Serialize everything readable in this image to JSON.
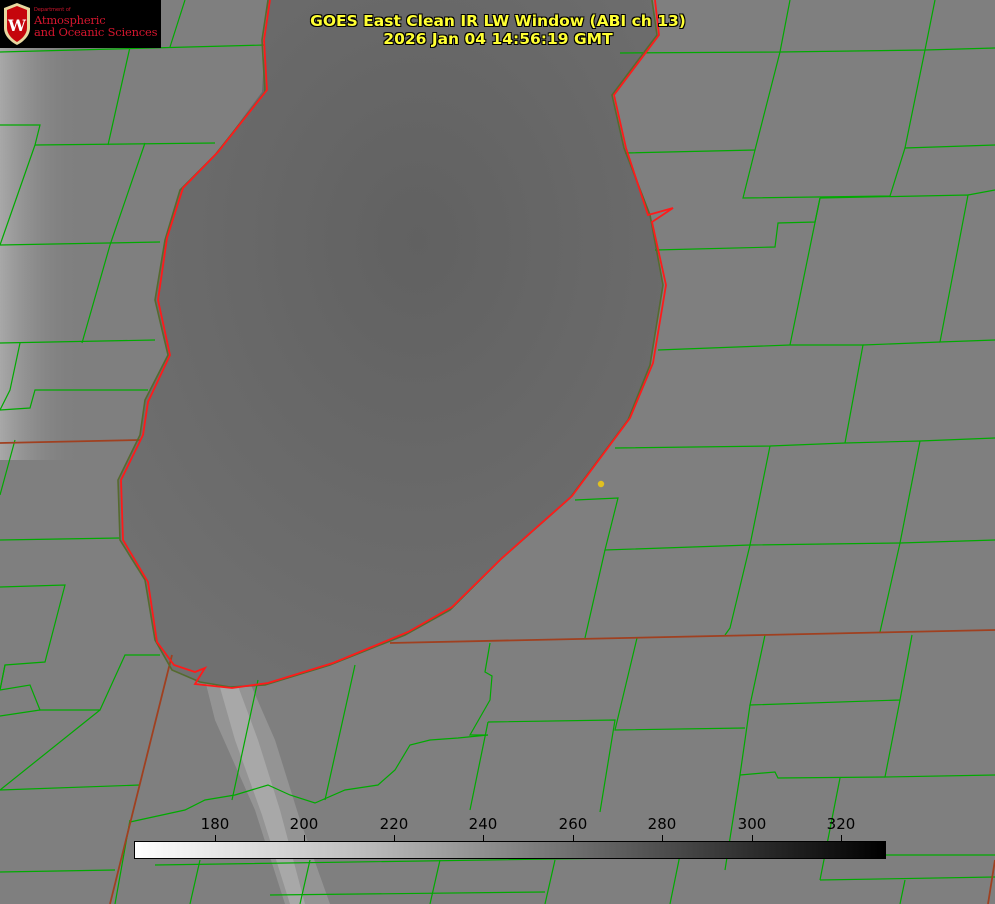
{
  "header": {
    "title_line1": "GOES East Clean IR LW Window (ABI ch 13)",
    "title_line2": "2026 Jan 04 14:56:19 GMT"
  },
  "logo": {
    "small_text": "Department of",
    "line1": "Atmospheric",
    "line2": "and Oceanic Sciences",
    "shield_letter": "W",
    "brand_color": "#c5050c"
  },
  "colorbar": {
    "ticks": [
      "180",
      "200",
      "220",
      "240",
      "260",
      "280",
      "300",
      "320"
    ],
    "min_color": "#ffffff",
    "max_color": "#000000"
  },
  "colors": {
    "county_lines": "#00aa00",
    "state_lines": "#a04020",
    "lake_outline": "#ff1a1a",
    "marker": "#e0c020",
    "background": "#7f7f7f",
    "lake_fill": "#6a6a6a"
  },
  "map": {
    "features": [
      "lake-michigan",
      "county-boundaries",
      "state-boundaries",
      "location-marker"
    ]
  }
}
